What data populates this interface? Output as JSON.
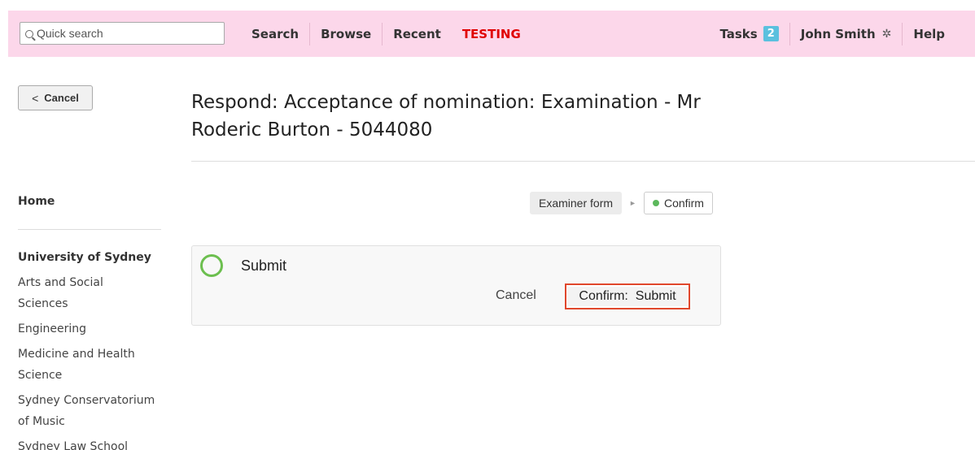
{
  "topbar": {
    "search_placeholder": "Quick search",
    "nav_left": [
      {
        "label": "Search"
      },
      {
        "label": "Browse"
      },
      {
        "label": "Recent"
      }
    ],
    "environment_label": "TESTING",
    "tasks_label": "Tasks",
    "tasks_count": "2",
    "user_name": "John Smith",
    "help_label": "Help"
  },
  "cancel_button": {
    "label": "Cancel",
    "icon": "chevron-left-icon"
  },
  "sidebar": {
    "home": "Home",
    "org": "University of Sydney",
    "links": [
      "Arts and Social Sciences",
      "Engineering",
      "Medicine and Health Science",
      "Sydney Conservatorium of Music",
      "Sydney Law School"
    ]
  },
  "page": {
    "title": "Respond: Acceptance of nomination: Examination - Mr Roderic Burton - 5044080"
  },
  "steps": [
    {
      "label": "Examiner form",
      "active": false
    },
    {
      "label": "Confirm",
      "active": true
    }
  ],
  "panel": {
    "title": "Submit",
    "cancel_label": "Cancel",
    "confirm_label": "Confirm:  Submit"
  },
  "colors": {
    "topbar_bg": "#fcd7ea",
    "testing": "#e00000",
    "badge": "#5bc0de",
    "accent_green": "#6cbf4f",
    "highlight_border": "#e0472c"
  }
}
